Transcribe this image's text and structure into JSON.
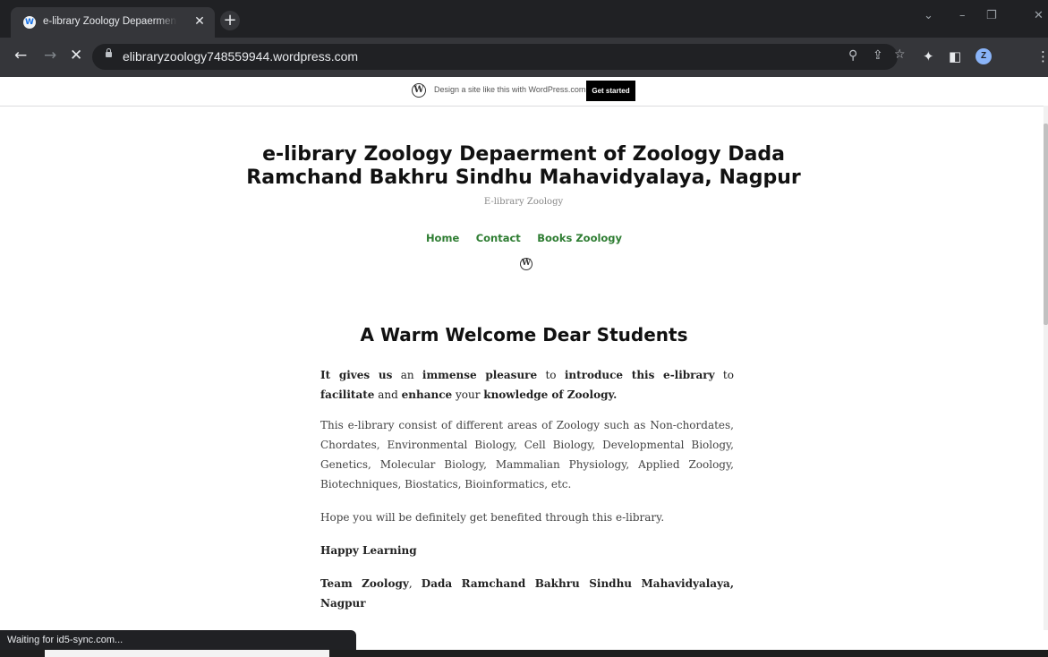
{
  "browser": {
    "tab_title": "e-library Zoology Depaerment of Zoology",
    "tab_favicon": "W",
    "close_glyph": "✕",
    "new_tab_glyph": "+",
    "url": "elibraryzoology748559944.wordpress.com",
    "avatar_letter": "Z",
    "status_text": "Waiting for id5-sync.com..."
  },
  "wp_banner": {
    "text": "Design a site like this with WordPress.com",
    "button": "Get started"
  },
  "site": {
    "title": "e-library Zoology Depaerment of Zoology Dada Ramchand Bakhru Sindhu Mahavidyalaya, Nagpur",
    "tagline": "E-library Zoology",
    "nav": [
      "Home",
      "Contact",
      "Books Zoology"
    ]
  },
  "content": {
    "heading": "A Warm Welcome Dear Students",
    "p1": {
      "s1": "It gives us",
      "s2": " an ",
      "s3": "immense pleasure",
      "s4": " to ",
      "s5": "introduce this e-library",
      "s6": " to ",
      "s7": "facilitate",
      "s8": " and ",
      "s9": "enhance",
      "s10": " your ",
      "s11": "knowledge of Zoology."
    },
    "p2": "This e-library consist of different areas of Zoology such as Non-chordates, Chordates, Environmental Biology, Cell Biology, Developmental Biology, Genetics, Molecular Biology, Mammalian Physiology, Applied Zoology, Biotechniques, Biostatics, Bioinformatics, etc.",
    "p3": "Hope you will be definitely get benefited through this e-library.",
    "p4": "Happy Learning",
    "p5": {
      "s1": "Team Zoology",
      "s2": ", ",
      "s3": "Dada Ramchand Bakhru Sindhu Mahavidyalaya, Nagpur"
    }
  },
  "icons": {
    "back": "back-arrow-icon",
    "forward": "forward-arrow-icon",
    "stop": "close-icon",
    "lock": "lock-icon",
    "zoom": "search-icon",
    "share": "share-icon",
    "bookmark": "star-icon",
    "extensions": "puzzle-icon",
    "sidepanel": "side-panel-icon",
    "menu": "kebab-menu-icon",
    "wordpress": "wordpress-logo-icon"
  },
  "colors": {
    "nav_link": "#2e7d32",
    "chrome_dark": "#202124",
    "chrome_toolbar": "#35363a"
  }
}
